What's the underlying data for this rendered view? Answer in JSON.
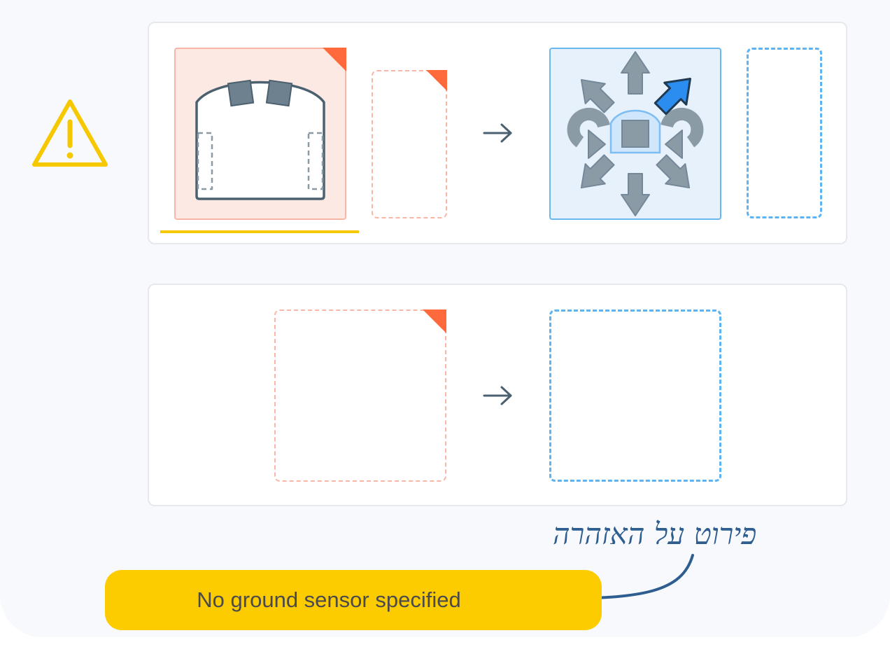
{
  "warning": {
    "icon": "warning-triangle-icon",
    "color": "#f6c800"
  },
  "rows": [
    {
      "event": {
        "icon": "robot-ground-sensor-icon",
        "selected": true
      },
      "action": {
        "icon": "move-arrows-icon",
        "highlighted_direction": "forward-right"
      }
    },
    {
      "event": {
        "icon": "empty-event-slot"
      },
      "action": {
        "icon": "empty-action-slot"
      }
    }
  ],
  "annotation": {
    "text": "פירוט על האזהרה"
  },
  "status": {
    "message": "No ground sensor specified"
  },
  "colors": {
    "event_accent": "#ff6a3d",
    "event_border": "#f8b6a6",
    "action_border": "#5fb3f0",
    "highlight_arrow": "#2b8df0",
    "status_bg": "#fdcc00"
  }
}
